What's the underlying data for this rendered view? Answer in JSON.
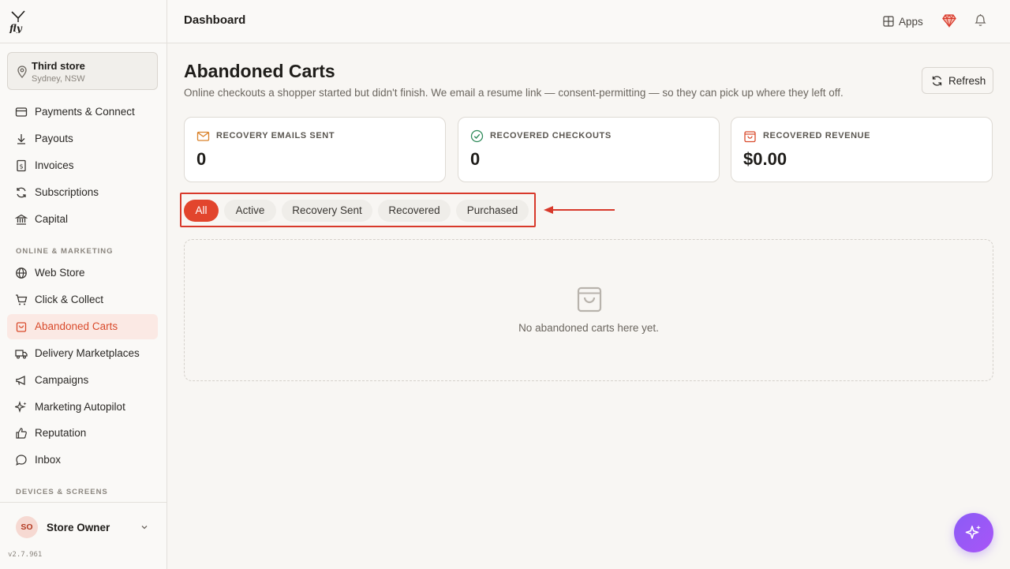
{
  "store": {
    "name": "Third store",
    "location": "Sydney, NSW"
  },
  "nav": {
    "items": [
      {
        "label": "Payments & Connect"
      },
      {
        "label": "Payouts"
      },
      {
        "label": "Invoices"
      },
      {
        "label": "Subscriptions"
      },
      {
        "label": "Capital"
      }
    ],
    "section_online": "ONLINE & MARKETING",
    "online_items": [
      {
        "label": "Web Store"
      },
      {
        "label": "Click & Collect"
      },
      {
        "label": "Abandoned Carts"
      },
      {
        "label": "Delivery Marketplaces"
      },
      {
        "label": "Campaigns"
      },
      {
        "label": "Marketing Autopilot"
      },
      {
        "label": "Reputation"
      },
      {
        "label": "Inbox"
      }
    ],
    "section_devices": "DEVICES & SCREENS"
  },
  "user": {
    "initials": "SO",
    "name": "Store Owner"
  },
  "version": "v2.7.961",
  "topbar": {
    "title": "Dashboard",
    "apps_label": "Apps"
  },
  "page": {
    "title": "Abandoned Carts",
    "subtitle": "Online checkouts a shopper started but didn't finish. We email a resume link — consent-permitting — so they can pick up where they left off.",
    "refresh_label": "Refresh"
  },
  "stats": [
    {
      "label": "RECOVERY EMAILS SENT",
      "value": "0"
    },
    {
      "label": "RECOVERED CHECKOUTS",
      "value": "0"
    },
    {
      "label": "RECOVERED REVENUE",
      "value": "$0.00"
    }
  ],
  "filters": {
    "selected": "All",
    "options": [
      "All",
      "Active",
      "Recovery Sent",
      "Recovered",
      "Purchased"
    ]
  },
  "empty_state": {
    "message": "No abandoned carts here yet."
  },
  "colors": {
    "accent": "#e2452d",
    "annotation": "#d8392b",
    "fab": "#8b5cf6"
  }
}
